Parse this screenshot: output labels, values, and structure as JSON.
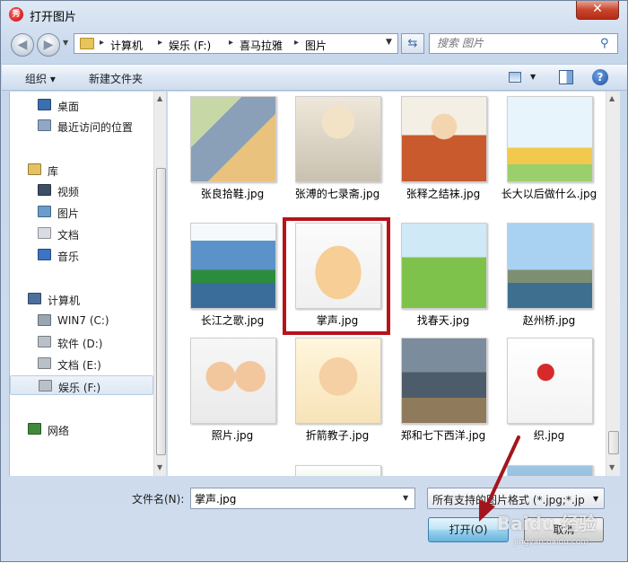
{
  "window": {
    "title": "打开图片",
    "app_icon_glyph": "秀"
  },
  "address": {
    "crumbs": [
      "计算机",
      "娱乐 (F:)",
      "喜马拉雅",
      "图片"
    ],
    "search_placeholder": "搜索 图片"
  },
  "toolbar": {
    "organize": "组织 ▾",
    "new_folder": "新建文件夹"
  },
  "nav": {
    "items": [
      {
        "label": "桌面",
        "icon": "desktop-icon",
        "color": "#3a6fb0"
      },
      {
        "label": "最近访问的位置",
        "icon": "recent-icon",
        "color": "#8fa8c8"
      },
      {
        "label": "库",
        "icon": "library-icon",
        "color": "#e6c160"
      },
      {
        "label": "视频",
        "icon": "video-icon",
        "color": "#3d4f66"
      },
      {
        "label": "图片",
        "icon": "pictures-icon",
        "color": "#6a9ccc"
      },
      {
        "label": "文档",
        "icon": "documents-icon",
        "color": "#d9dde3"
      },
      {
        "label": "音乐",
        "icon": "music-icon",
        "color": "#3b74c2"
      },
      {
        "label": "计算机",
        "icon": "computer-icon",
        "color": "#4d6f9c"
      },
      {
        "label": "WIN7 (C:)",
        "icon": "drive-c-icon",
        "color": "#9aa6b4"
      },
      {
        "label": "软件 (D:)",
        "icon": "drive-icon",
        "color": "#b9c0c8"
      },
      {
        "label": "文档 (E:)",
        "icon": "drive-icon",
        "color": "#b9c0c8"
      },
      {
        "label": "娱乐 (F:)",
        "icon": "drive-icon",
        "color": "#b9c0c8"
      },
      {
        "label": "网络",
        "icon": "network-icon",
        "color": "#3f8a3a"
      }
    ],
    "selected_index": 11
  },
  "files": [
    {
      "name": "张良拾鞋.jpg"
    },
    {
      "name": "张溥的七录斋.jpg"
    },
    {
      "name": "张释之结袜.jpg"
    },
    {
      "name": "长大以后做什么.jpg"
    },
    {
      "name": "长江之歌.jpg"
    },
    {
      "name": "掌声.jpg"
    },
    {
      "name": "找春天.jpg"
    },
    {
      "name": "赵州桥.jpg"
    },
    {
      "name": "照片.jpg"
    },
    {
      "name": "折箭教子.jpg"
    },
    {
      "name": "郑和七下西洋.jpg"
    },
    {
      "name": "织.jpg"
    }
  ],
  "bottom": {
    "filename_label": "文件名(N):",
    "filename_value": "掌声.jpg",
    "filetype": "所有支持的图片格式 (*.jpg;*.jp",
    "open": "打开(O)",
    "cancel": "取消"
  },
  "watermark": {
    "main": "Baidu 经验",
    "sub": "jingyan.baidu.com"
  },
  "colors": {
    "highlight": "#b9121b",
    "arrow": "#a3151c",
    "accent": "#3c7fb1"
  }
}
